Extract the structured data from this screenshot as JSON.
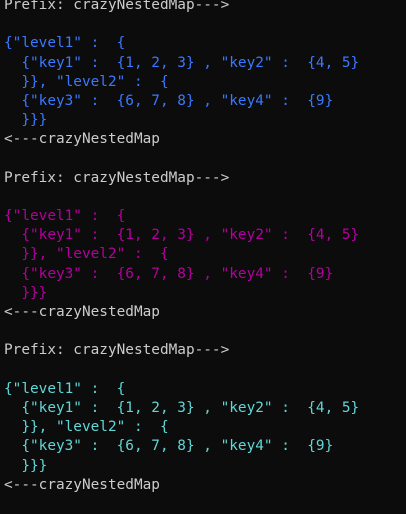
{
  "terminal": {
    "blocks": [
      {
        "prefix": "Prefix: crazyNestedMap--->",
        "lines": [
          "{\"level1\" :  {",
          "  {\"key1\" :  {1, 2, 3} , \"key2\" :  {4, 5}",
          "  }}, \"level2\" :  {",
          "  {\"key3\" :  {6, 7, 8} , \"key4\" :  {9}",
          "  }}}"
        ],
        "footer": "<---crazyNestedMap",
        "color": "#3b78ff"
      },
      {
        "prefix": "Prefix: crazyNestedMap--->",
        "lines": [
          "{\"level1\" :  {",
          "  {\"key1\" :  {1, 2, 3} , \"key2\" :  {4, 5}",
          "  }}, \"level2\" :  {",
          "  {\"key3\" :  {6, 7, 8} , \"key4\" :  {9}",
          "  }}}"
        ],
        "footer": "<---crazyNestedMap",
        "color": "#b4009e"
      },
      {
        "prefix": "Prefix: crazyNestedMap--->",
        "lines": [
          "{\"level1\" :  {",
          "  {\"key1\" :  {1, 2, 3} , \"key2\" :  {4, 5}",
          "  }}, \"level2\" :  {",
          "  {\"key3\" :  {6, 7, 8} , \"key4\" :  {9}",
          "  }}}"
        ],
        "footer": "<---crazyNestedMap",
        "color": "#61d6d6"
      }
    ]
  }
}
